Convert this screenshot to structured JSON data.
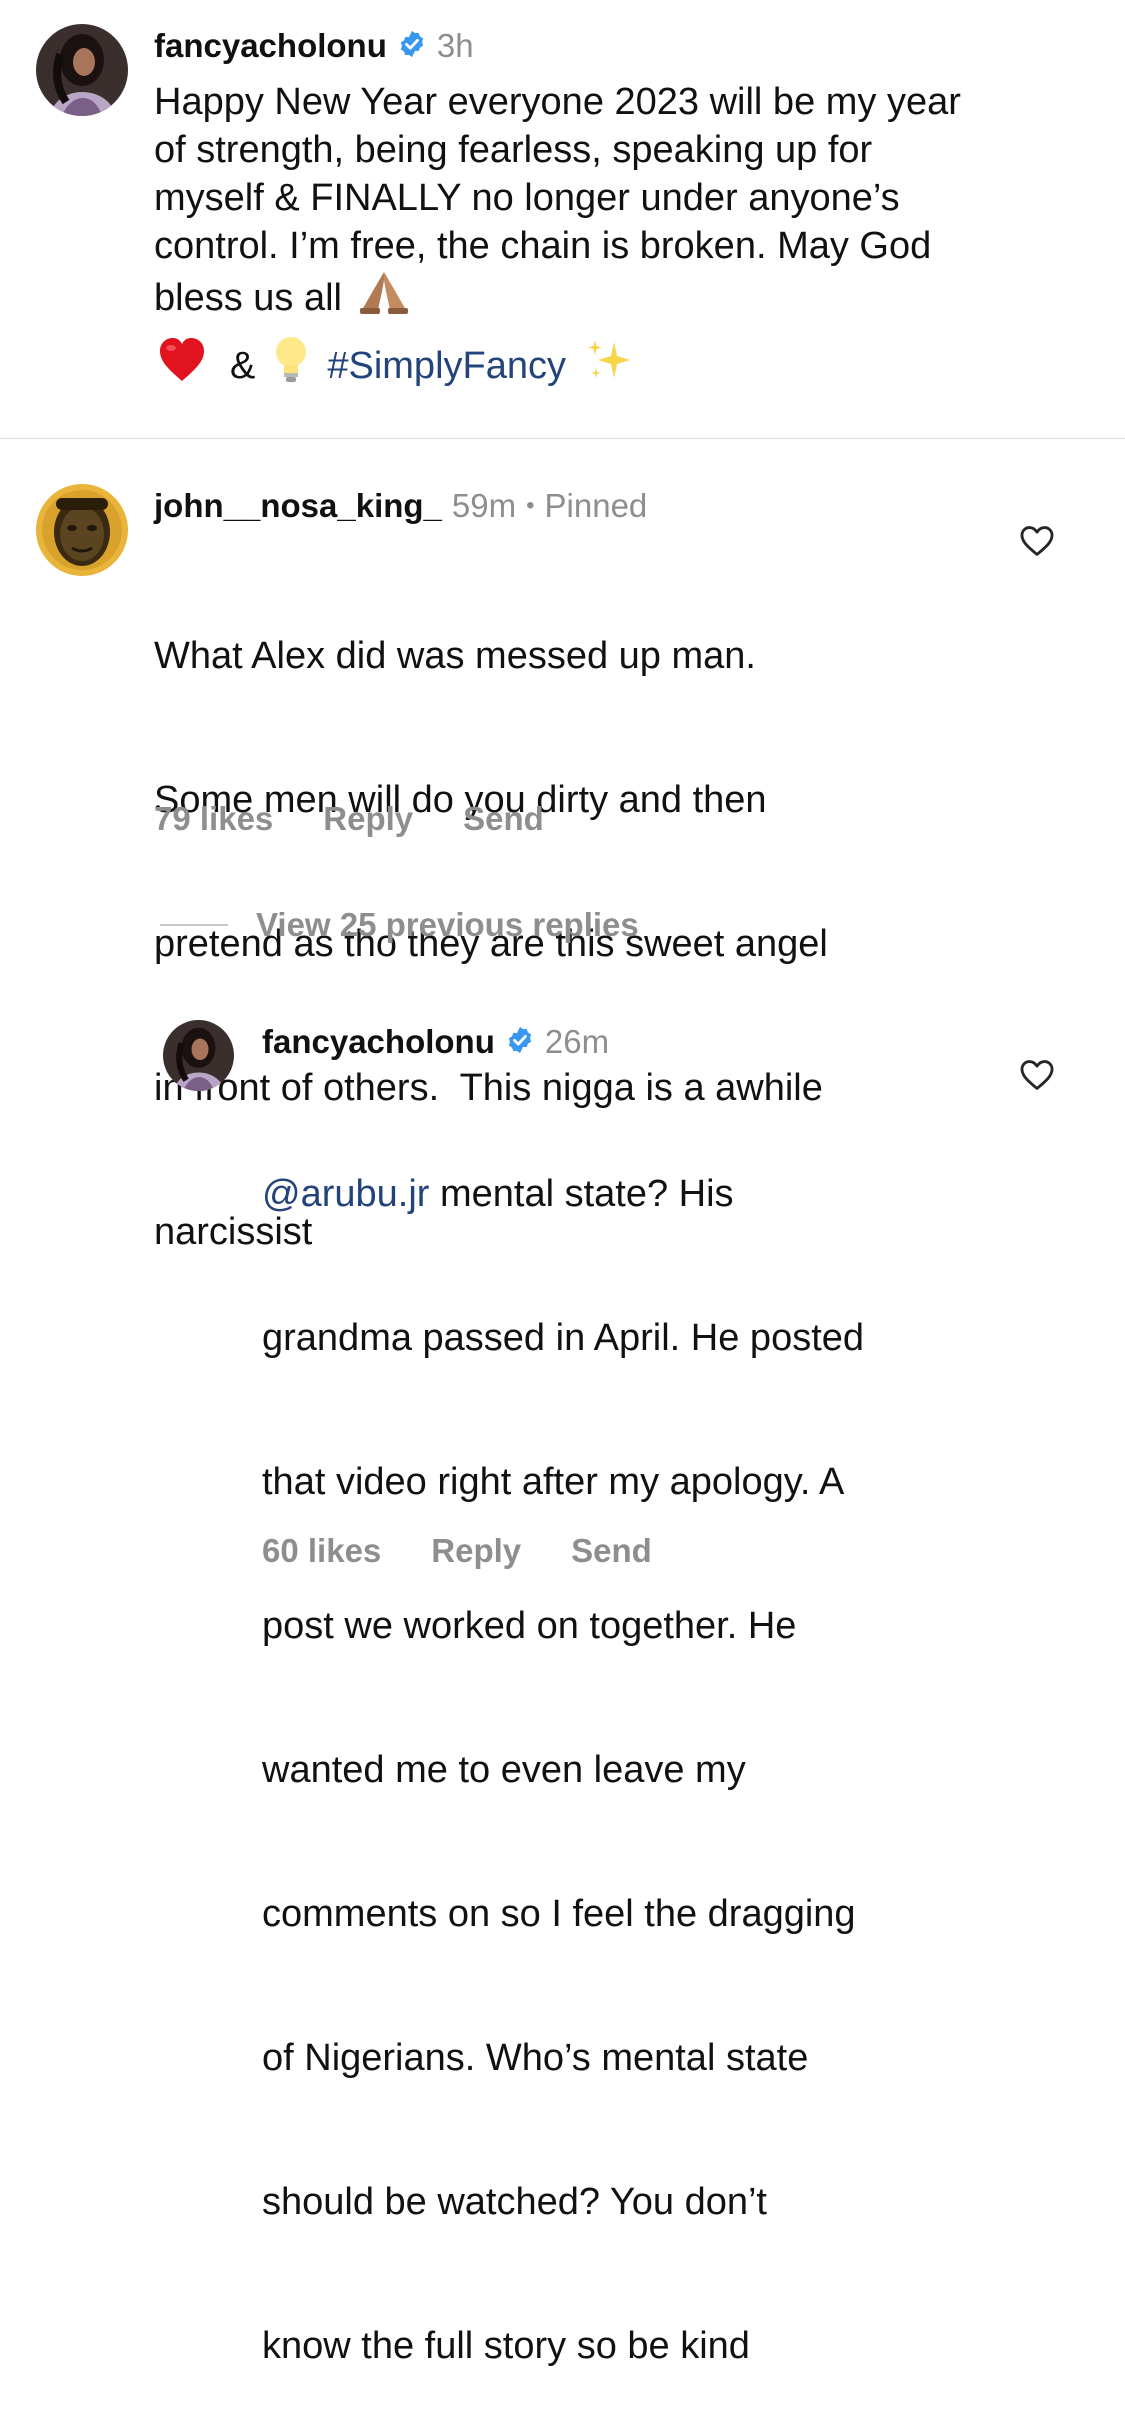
{
  "post": {
    "username": "fancyacholonu",
    "time": "3h",
    "caption_lines": [
      "Happy New Year everyone 2023 will be my year",
      "of strength, being fearless, speaking up for",
      "myself & FINALLY no longer under anyone’s",
      "control. I’m free, the chain is broken. May God",
      "bless us all"
    ],
    "caption_tail_amp": "&",
    "hashtag": "#SimplyFancy"
  },
  "comment": {
    "username": "john__nosa_king_",
    "time": "59m",
    "separator": "•",
    "pinned": "Pinned",
    "lines": [
      "What Alex did was messed up man.",
      "Some men will do you dirty and then",
      "pretend as tho they are this sweet angel",
      "in front of others.  This nigga is a awhile",
      "narcissist"
    ],
    "likes": "79 likes",
    "reply": "Reply",
    "send": "Send"
  },
  "view_replies": "View 25 previous replies",
  "reply": {
    "username": "fancyacholonu",
    "time": "26m",
    "mention": "@arubu.jr",
    "first_line_rest": " mental state? His",
    "lines": [
      "grandma passed in April. He posted",
      "that video right after my apology. A",
      "post we worked on together. He",
      "wanted me to even leave my",
      "comments on so I feel the dragging",
      "of Nigerians. Who’s mental state",
      "should be watched? You don’t",
      "know the full story so be kind"
    ],
    "likes": "60 likes",
    "reply": "Reply",
    "send": "Send"
  },
  "colors": {
    "verified": "#3897f0",
    "link": "#23447a",
    "meta": "#8e8e8e"
  },
  "icons": [
    "verified-badge-icon",
    "praying-hands-icon",
    "red-heart-icon",
    "light-bulb-icon",
    "sparkles-icon",
    "heart-outline-icon"
  ]
}
